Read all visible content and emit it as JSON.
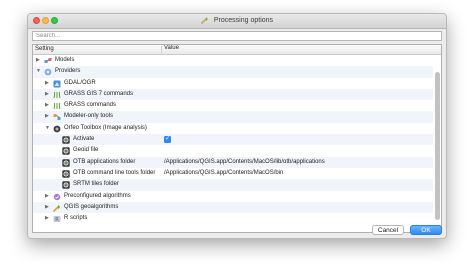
{
  "window": {
    "title": "Processing options"
  },
  "search": {
    "placeholder": "Search..."
  },
  "columns": {
    "setting": "Setting",
    "value": "Value"
  },
  "rows": [
    {
      "label": "Models",
      "icon": "models-icon",
      "arrow": "▶",
      "value": ""
    },
    {
      "label": "Providers",
      "icon": "providers-icon",
      "arrow": "▼",
      "value": ""
    },
    {
      "label": "GDAL/OGR",
      "icon": "gdal-icon",
      "arrow": "▶",
      "value": ""
    },
    {
      "label": "GRASS GIS 7 commands",
      "icon": "grass-icon",
      "arrow": "▶",
      "value": ""
    },
    {
      "label": "GRASS commands",
      "icon": "grass-icon",
      "arrow": "▶",
      "value": ""
    },
    {
      "label": "Modeler-only tools",
      "icon": "modeler-icon",
      "arrow": "▶",
      "value": ""
    },
    {
      "label": "Orfeo Toolbox (Image analysis)",
      "icon": "orfeo-icon",
      "arrow": "▼",
      "value": ""
    },
    {
      "label": "Activate",
      "icon": "setting-icon",
      "arrow": "",
      "value": "",
      "checked": true
    },
    {
      "label": "Geoid file",
      "icon": "setting-icon",
      "arrow": "",
      "value": ""
    },
    {
      "label": "OTB applications folder",
      "icon": "setting-icon",
      "arrow": "",
      "value": "/Applications/QGIS.app/Contents/MacOS/lib/otb/applications"
    },
    {
      "label": "OTB command line tools folder",
      "icon": "setting-icon",
      "arrow": "",
      "value": "/Applications/QGIS.app/Contents/MacOS/bin"
    },
    {
      "label": "SRTM tiles folder",
      "icon": "setting-icon",
      "arrow": "",
      "value": ""
    },
    {
      "label": "Preconfigured algorithms",
      "icon": "preconfigured-icon",
      "arrow": "▶",
      "value": ""
    },
    {
      "label": "QGIS geoalgorithms",
      "icon": "qgis-icon",
      "arrow": "▶",
      "value": ""
    },
    {
      "label": "R scripts",
      "icon": "r-scripts-icon",
      "arrow": "▶",
      "value": ""
    }
  ],
  "buttons": {
    "cancel": "Cancel",
    "ok": "OK"
  },
  "colors": {
    "accent": "#2f87f6",
    "ok_button": "#2d8cf0",
    "row_alt": "#f1f4fa"
  }
}
